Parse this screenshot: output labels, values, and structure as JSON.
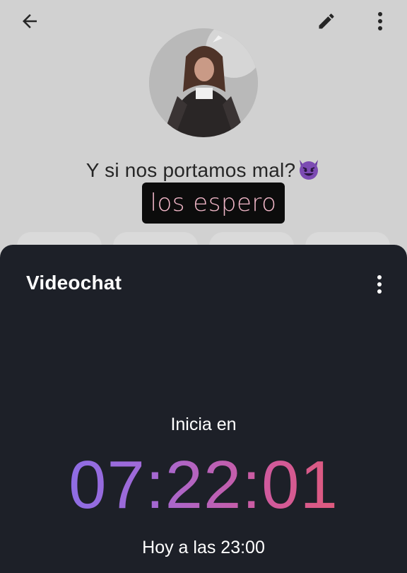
{
  "group": {
    "status": "Y si nos portamos mal?",
    "status_emoji": "smiling-face-with-horns",
    "note": "los espero"
  },
  "top_bar": {
    "back_icon": "arrow-left-icon",
    "edit_icon": "pencil-icon",
    "more_icon": "more-vertical-icon"
  },
  "sheet": {
    "title": "Videochat",
    "more_icon": "more-vertical-icon",
    "starts_label": "Inicia en",
    "countdown": "07:22:01",
    "start_time": "Hoy a las 23:00"
  },
  "colors": {
    "sheet_background": "#1d2028",
    "countdown_gradient": [
      "#7d6ef0",
      "#a06ad7",
      "#cf5a9e",
      "#ee5a5c"
    ],
    "note_text": "#f1b7c8"
  }
}
